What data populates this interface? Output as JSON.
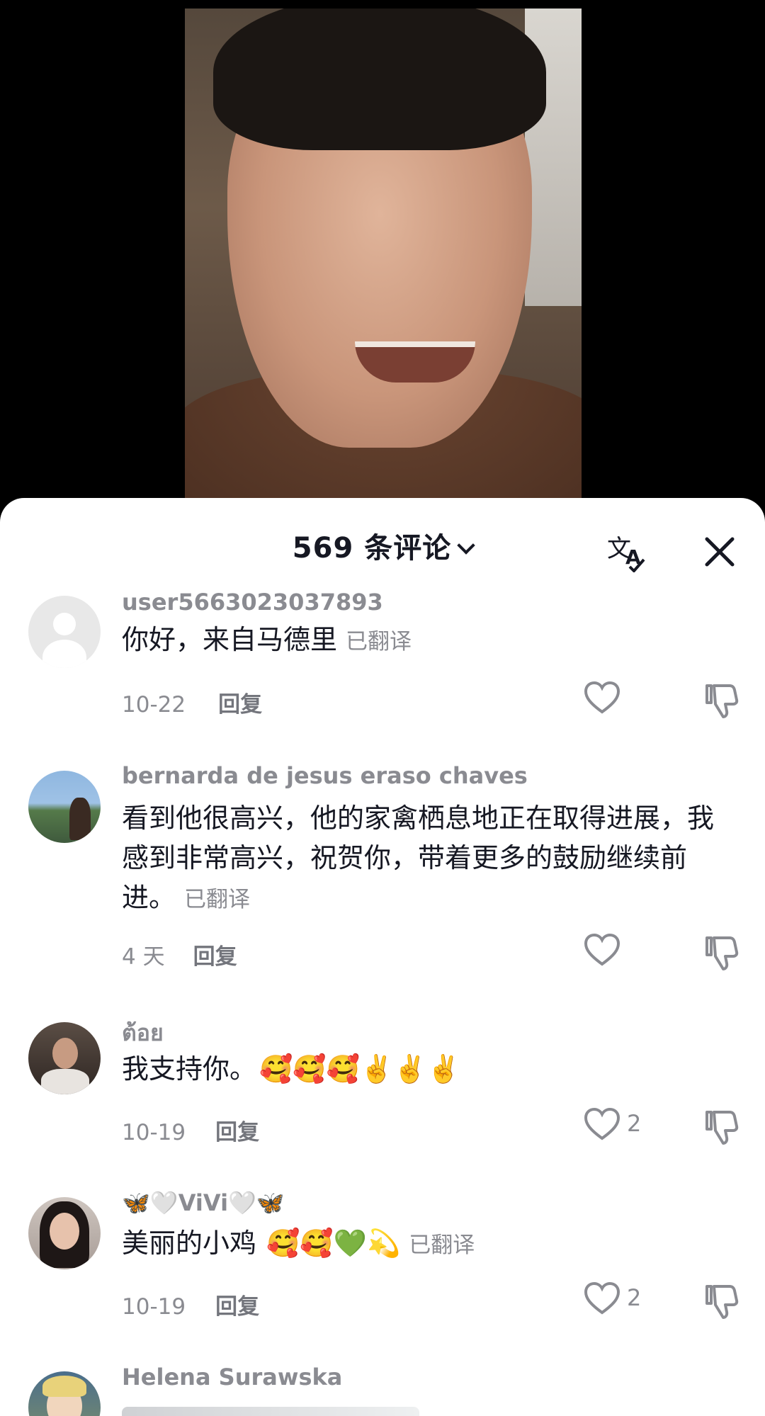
{
  "header": {
    "count_title": "569 条评论",
    "translate_icon": "translate-icon",
    "close_icon": "close-icon"
  },
  "comments": [
    {
      "user": "user5663023037893",
      "text": "你好，来自马德里",
      "translated": "已翻译",
      "time": "10-22",
      "reply": "回复",
      "likes": ""
    },
    {
      "user": "bernarda de jesus eraso chaves",
      "text": "看到他很高兴，他的家禽栖息地正在取得进展，我感到非常高兴，祝贺你，带着更多的鼓励继续前进。",
      "translated": "已翻译",
      "time": "4 天",
      "reply": "回复",
      "likes": ""
    },
    {
      "user": "ต้อย",
      "text": "我支持你。",
      "emojis": "🥰🥰🥰✌️✌️✌️",
      "translated": "",
      "time": "10-19",
      "reply": "回复",
      "likes": "2"
    },
    {
      "user": "🦋🤍ViVi🤍🦋",
      "text": "美丽的小鸡",
      "emojis": "🥰🥰💚💫",
      "translated": "已翻译",
      "time": "10-19",
      "reply": "回复",
      "likes": "2"
    },
    {
      "user": "Helena Surawska"
    }
  ]
}
